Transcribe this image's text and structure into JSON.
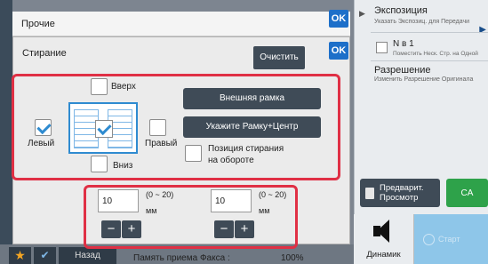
{
  "header": {
    "title": "Прочие",
    "ok_label": "OK"
  },
  "right_panel": {
    "exposure_title": "Экспозиция",
    "exposure_sub": "Указать Экспозиц. для Передачи",
    "n_in_1_title": "N в 1",
    "n_in_1_sub": "Поместить Неск. Стр. на Одной",
    "resolution_title": "Разрешение",
    "resolution_sub": "Изменить Разрешение Оригинала"
  },
  "erase_dialog": {
    "title": "Стирание",
    "ok_label": "OK",
    "clear_label": "Очистить",
    "top_label": "Вверх",
    "left_label": "Левый",
    "right_label": "Правый",
    "bottom_label": "Вниз",
    "outer_frame_label": "Внешняя рамка",
    "frame_center_label": "Укажите Рамку+Центр",
    "back_pos_label_1": "Позиция стирания",
    "back_pos_label_2": "на обороте",
    "checked": {
      "top": false,
      "left": true,
      "right": false,
      "bottom": false,
      "center": true,
      "back": false
    },
    "field1": {
      "value": "10",
      "range": "(0 ~ 20)",
      "unit": "мм"
    },
    "field2": {
      "value": "10",
      "range": "(0 ~ 20)",
      "unit": "мм"
    },
    "minus": "−",
    "plus": "+"
  },
  "actions": {
    "preview_line1": "Предварит.",
    "preview_line2": "Просмотр",
    "ca_label": "CA",
    "speaker_label": "Динамик",
    "start_label": "Старт"
  },
  "bottom_bar": {
    "back_label": "Назад",
    "fax_memory_label": "Память приема Факса :",
    "fax_memory_value": "100%"
  },
  "colors": {
    "highlight": "#e03045",
    "accent": "#1d6fc9",
    "ca": "#2ea24a"
  }
}
